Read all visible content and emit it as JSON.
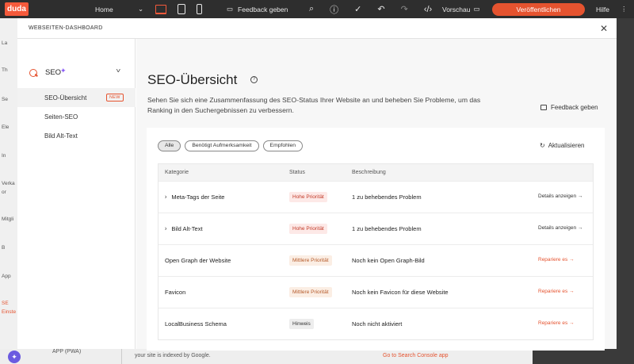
{
  "topbar": {
    "logo": "duda",
    "home": "Home",
    "feedback": "Feedback geben",
    "preview": "Vorschau",
    "publish": "Veröffentlichen",
    "help": "Hilfe",
    "accent_color": "#e5532f"
  },
  "background": {
    "left_labels": [
      "La",
      "Th",
      "Se",
      "Ele",
      "In",
      "Verka",
      "or",
      "Mitgli",
      "B",
      "App",
      "SE",
      "Einste"
    ],
    "bottom_app": "APP (PWA)",
    "bottom_text": "your site is indexed by Google.",
    "bottom_link": "Go to Search Console app"
  },
  "modal": {
    "title": "WEBSEITEN-DASHBOARD",
    "close_icon": "close-icon"
  },
  "sidebar": {
    "section_label": "SEO",
    "items": [
      {
        "label": "SEO-Übersicht",
        "badge": "NEW"
      },
      {
        "label": "Seiten-SEO"
      },
      {
        "label": "Bild Alt-Text"
      }
    ]
  },
  "main": {
    "title": "SEO-Übersicht",
    "description": "Sehen Sie sich eine Zusammenfassung des SEO-Status Ihrer Website an und beheben Sie Probleme, um das Ranking in den Suchergebnissen zu verbessern.",
    "feedback_link": "Feedback geben",
    "filters": [
      "Alle",
      "Benötigt Aufmerksamkeit",
      "Empfohlen"
    ],
    "refresh": "Aktualisieren",
    "table": {
      "headers": [
        "Kategorie",
        "Status",
        "Beschreibung"
      ],
      "rows": [
        {
          "category": "Meta-Tags der Seite",
          "status": "Hohe Priorität",
          "description": "1 zu behebendes Problem",
          "action": "Details anzeigen →"
        },
        {
          "category": "Bild Alt-Text",
          "status": "Hohe Priorität",
          "description": "1 zu behebendes Problem",
          "action": "Details anzeigen →"
        },
        {
          "category": "Open Graph der Website",
          "status": "Mittlere Priorität",
          "description": "Noch kein Open Graph-Bild",
          "action": "Repariere es →"
        },
        {
          "category": "Favicon",
          "status": "Mittlere Priorität",
          "description": "Noch kein Favicon für diese Website",
          "action": "Repariere es →"
        },
        {
          "category": "LocalBusiness Schema",
          "status": "Hinweis",
          "description": "Noch nicht aktiviert",
          "action": "Repariere es →"
        }
      ]
    }
  }
}
